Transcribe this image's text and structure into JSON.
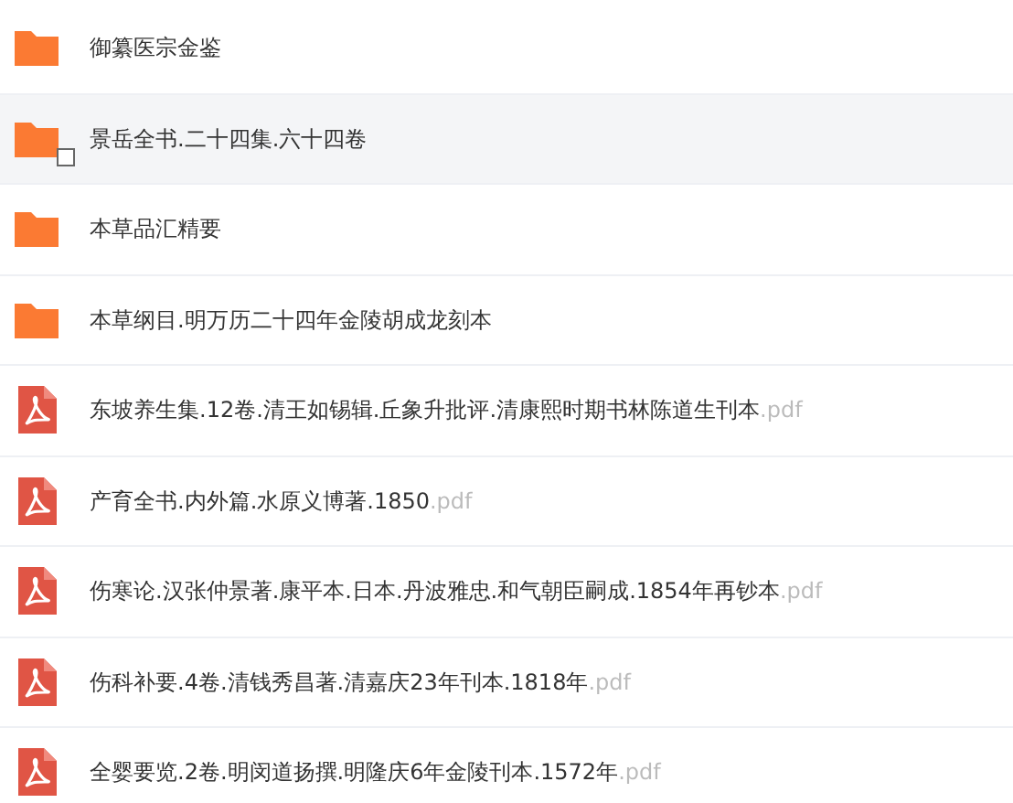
{
  "files": [
    {
      "kind": "folder",
      "name": "御纂医宗金鉴",
      "hovered": false
    },
    {
      "kind": "folder",
      "name": "景岳全书.二十四集.六十四卷",
      "hovered": true
    },
    {
      "kind": "folder",
      "name": "本草品汇精要",
      "hovered": false
    },
    {
      "kind": "folder",
      "name": "本草纲目.明万历二十四年金陵胡成龙刻本",
      "hovered": false
    },
    {
      "kind": "pdf",
      "name": "东坡养生集.12卷.清王如锡辑.丘象升批评.清康熙时期书林陈道生刊本",
      "ext": ".pdf",
      "hovered": false
    },
    {
      "kind": "pdf",
      "name": "产育全书.内外篇.水原义博著.1850",
      "ext": ".pdf",
      "hovered": false
    },
    {
      "kind": "pdf",
      "name": "伤寒论.汉张仲景著.康平本.日本.丹波雅忠.和气朝臣嗣成.1854年再钞本",
      "ext": ".pdf",
      "hovered": false
    },
    {
      "kind": "pdf",
      "name": "伤科补要.4卷.清钱秀昌著.清嘉庆23年刊本.1818年",
      "ext": ".pdf",
      "hovered": false
    },
    {
      "kind": "pdf",
      "name": "全婴要览.2卷.明闵道扬撰.明隆庆6年金陵刊本.1572年",
      "ext": ".pdf",
      "hovered": false
    }
  ]
}
